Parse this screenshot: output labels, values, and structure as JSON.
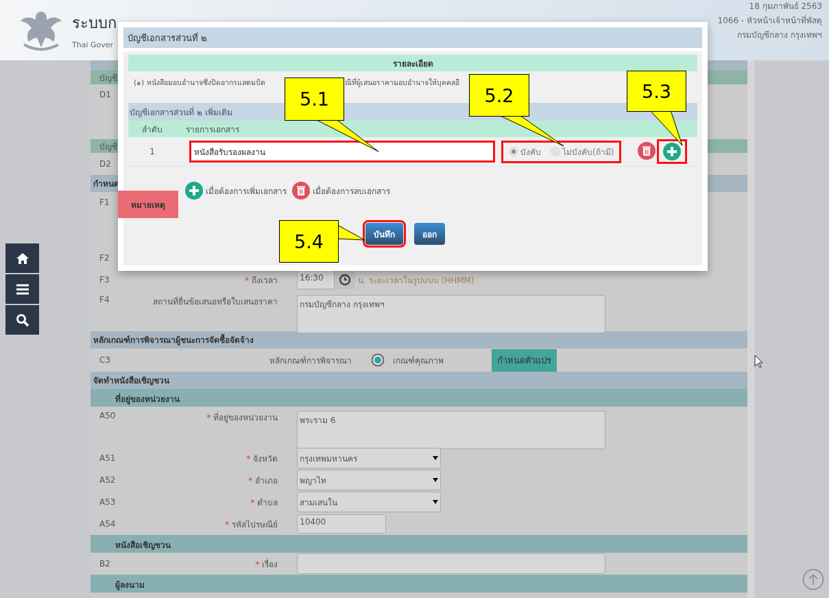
{
  "header": {
    "title": "ระบบก",
    "subtitle": "Thai Gover",
    "date": "18 กุมภาพันธ์ 2563",
    "user": "1066 - หัวหน้าเจ้าหน้าที่พัสดุ",
    "org": "กรมบัญชีกลาง กรุงเทพฯ"
  },
  "form_rows": [
    {
      "kind": "group",
      "text": "บัญชี"
    },
    {
      "kind": "covered_tall",
      "code": "D1"
    },
    {
      "kind": "group",
      "text": "บัญชี"
    },
    {
      "kind": "covered",
      "code": "D2"
    },
    {
      "kind": "section",
      "text": "กำหนด"
    },
    {
      "kind": "covered_tall",
      "code": "F1"
    },
    {
      "kind": "covered",
      "code": "F2"
    },
    {
      "kind": "time",
      "code": "F3",
      "marker": "*",
      "label": "ถึงเวลา",
      "value": "16:30",
      "hint": "น. ระยะเวลาในรูปแบบ (HHMM)"
    },
    {
      "kind": "textarea",
      "code": "F4",
      "label": "สถานที่ยื่นข้อเสนอหรือใบเสนอราคา",
      "value": "กรมบัญชีกลาง กรุงเทพฯ"
    },
    {
      "kind": "section",
      "text": "หลักเกณฑ์การพิจารณาผู้ชนะการจัดซื้อจัดจ้าง"
    },
    {
      "kind": "radio",
      "code": "C3",
      "label": "หลักเกณฑ์การพิจารณา",
      "option": "เกณฑ์คุณภาพ",
      "selected": true,
      "button": "กำหนดตัวแปร"
    },
    {
      "kind": "section",
      "text": "จัดทำหนังสือเชิญชวน"
    },
    {
      "kind": "subsection",
      "text": "ที่อยู่ของหน่วยงาน"
    },
    {
      "kind": "textarea",
      "code": "A50",
      "marker": "*",
      "label": "ที่อยู่ของหน่วยงาน",
      "value": "พระราม 6"
    },
    {
      "kind": "select",
      "code": "A51",
      "marker": "*",
      "label": "จังหวัด",
      "value": "กรุงเทพมหานคร"
    },
    {
      "kind": "select",
      "code": "A52",
      "marker": "*",
      "label": "อำเภอ",
      "value": "พญาไท"
    },
    {
      "kind": "select",
      "code": "A53",
      "marker": "*",
      "label": "ตำบล",
      "value": "สามเสนใน"
    },
    {
      "kind": "text",
      "code": "A54",
      "marker": "*",
      "label": "รหัสไปรษณีย์",
      "value": "10400"
    },
    {
      "kind": "subsection",
      "text": "หนังสือเชิญชวน"
    },
    {
      "kind": "wide_text",
      "code": "B2",
      "marker": "*",
      "label": "เรื่อง"
    },
    {
      "kind": "subsection",
      "text": "ผู้ลงนาม"
    }
  ],
  "modal": {
    "title": "บัญชีเอกสารส่วนที่ ๒",
    "detail_heading": "รายละเอียด",
    "detail_text_parts": [
      "(๑) หนังสือมอบอำนาจซึ่งปิดอากรแสตมป์ต",
      "ณีที่ผู้เสนอราคามอบอำนาจให้บุคคลอื"
    ],
    "extra_heading": "บัญชีเอกสารส่วนที่ ๒ เพิ่มเติม",
    "columns": [
      "ลำดับ",
      "รายการเอกสาร"
    ],
    "rows": [
      {
        "index": "1",
        "value": "หนังสือรับรองผลงาน",
        "highlighted": true,
        "options_highlighted": true,
        "add_highlighted": true,
        "options": [
          {
            "label": "บังคับ",
            "selected": true
          },
          {
            "label": "ไม่บังคับ(ถ้ามี)",
            "selected": false
          }
        ]
      }
    ],
    "legend": [
      "เมื่อต้องการเพิ่มเอกสาร",
      "เมื่อต้องการลบเอกสาร"
    ],
    "buttons": [
      {
        "label": "บันทึก",
        "highlighted": true
      },
      {
        "label": "ออก",
        "highlighted": false
      }
    ]
  },
  "note_tag": "หมายเหตุ",
  "callouts": [
    {
      "label": "5.1"
    },
    {
      "label": "5.2"
    },
    {
      "label": "5.3"
    },
    {
      "label": "5.4"
    }
  ]
}
